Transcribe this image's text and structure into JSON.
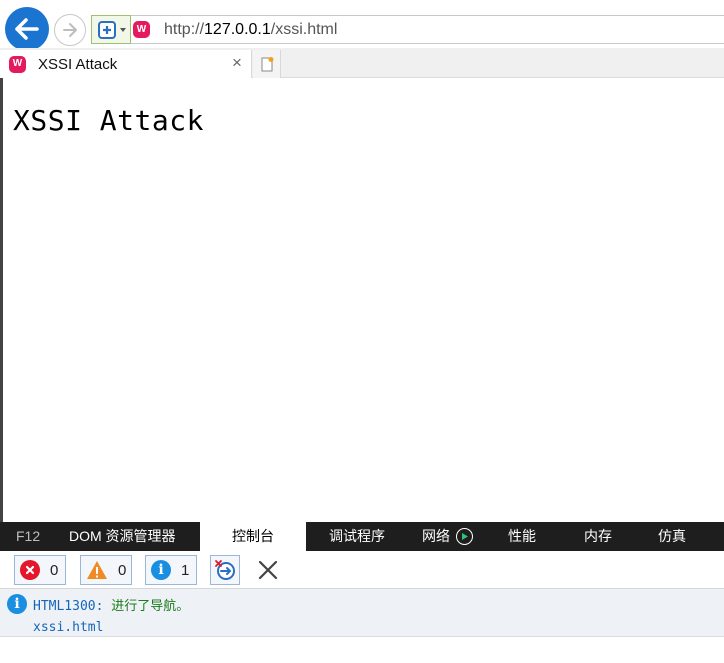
{
  "browser": {
    "url_prefix": "http://",
    "url_host": "127.0.0.1",
    "url_path": "/xssi.html",
    "site_icon_glyph": "W",
    "tab_title": "XSSI Attack",
    "tab_close_glyph": "×"
  },
  "page": {
    "heading": "XSSI Attack"
  },
  "devtools": {
    "tabs": {
      "f12": "F12",
      "dom": "DOM 资源管理器",
      "console": "控制台",
      "debugger": "调试程序",
      "network": "网络",
      "performance": "性能",
      "memory": "内存",
      "emulation": "仿真"
    },
    "counts": {
      "errors": "0",
      "warnings": "0",
      "info": "1"
    },
    "messages": [
      {
        "code": "HTML1300:",
        "text": "进行了导航。",
        "source": "xssi.html"
      }
    ]
  },
  "colors": {
    "accent_blue": "#1a74d0",
    "error_red": "#e3162a",
    "warning_orange": "#f08a24",
    "info_blue": "#1a8ee0",
    "site_icon_pink": "#e5195f"
  }
}
